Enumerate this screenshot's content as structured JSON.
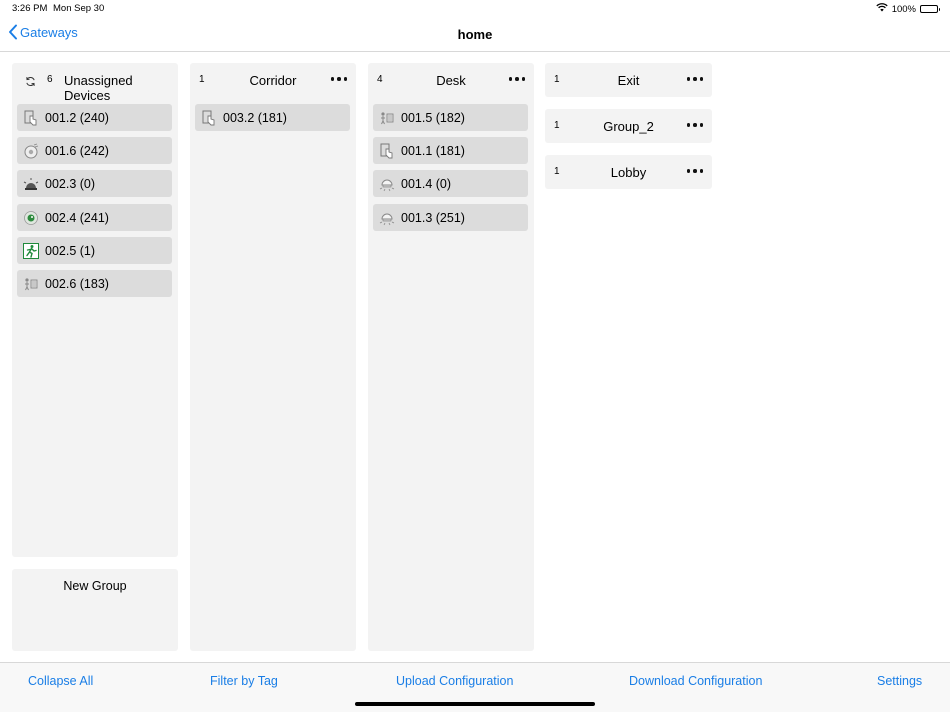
{
  "status_bar": {
    "time": "3:26 PM",
    "date": "Mon Sep 30",
    "battery": "100%"
  },
  "nav": {
    "back_label": "Gateways",
    "title": "home"
  },
  "unassigned": {
    "count": "6",
    "title": "Unassigned Devices",
    "devices": [
      {
        "label": "001.2 (240)",
        "icon": "touch-panel-icon"
      },
      {
        "label": "001.6 (242)",
        "icon": "sensor-disc-icon"
      },
      {
        "label": "002.3 (0)",
        "icon": "siren-icon"
      },
      {
        "label": "002.4 (241)",
        "icon": "green-sensor-icon"
      },
      {
        "label": "002.5 (1)",
        "icon": "emergency-exit-icon"
      },
      {
        "label": "002.6 (183)",
        "icon": "multi-sensor-icon"
      }
    ],
    "new_group_label": "New Group"
  },
  "groups": [
    {
      "count": "1",
      "title": "Corridor",
      "devices": [
        {
          "label": "003.2 (181)",
          "icon": "touch-panel-icon"
        }
      ]
    },
    {
      "count": "4",
      "title": "Desk",
      "devices": [
        {
          "label": "001.5 (182)",
          "icon": "multi-sensor-icon"
        },
        {
          "label": "001.1 (181)",
          "icon": "touch-panel-icon"
        },
        {
          "label": "001.4 (0)",
          "icon": "ceiling-lamp-icon"
        },
        {
          "label": "001.3 (251)",
          "icon": "ceiling-lamp-icon"
        }
      ]
    },
    {
      "count": "1",
      "title": "Exit",
      "devices": []
    },
    {
      "count": "1",
      "title": "Group_2",
      "devices": []
    },
    {
      "count": "1",
      "title": "Lobby",
      "devices": []
    }
  ],
  "toolbar": {
    "collapse_all": "Collapse All",
    "filter_by_tag": "Filter by Tag",
    "upload_configuration": "Upload Configuration",
    "download_configuration": "Download Configuration",
    "settings": "Settings"
  },
  "colors": {
    "accent": "#1a7ee6",
    "column_bg": "#f3f3f3",
    "device_bg": "#dcdcdc"
  }
}
